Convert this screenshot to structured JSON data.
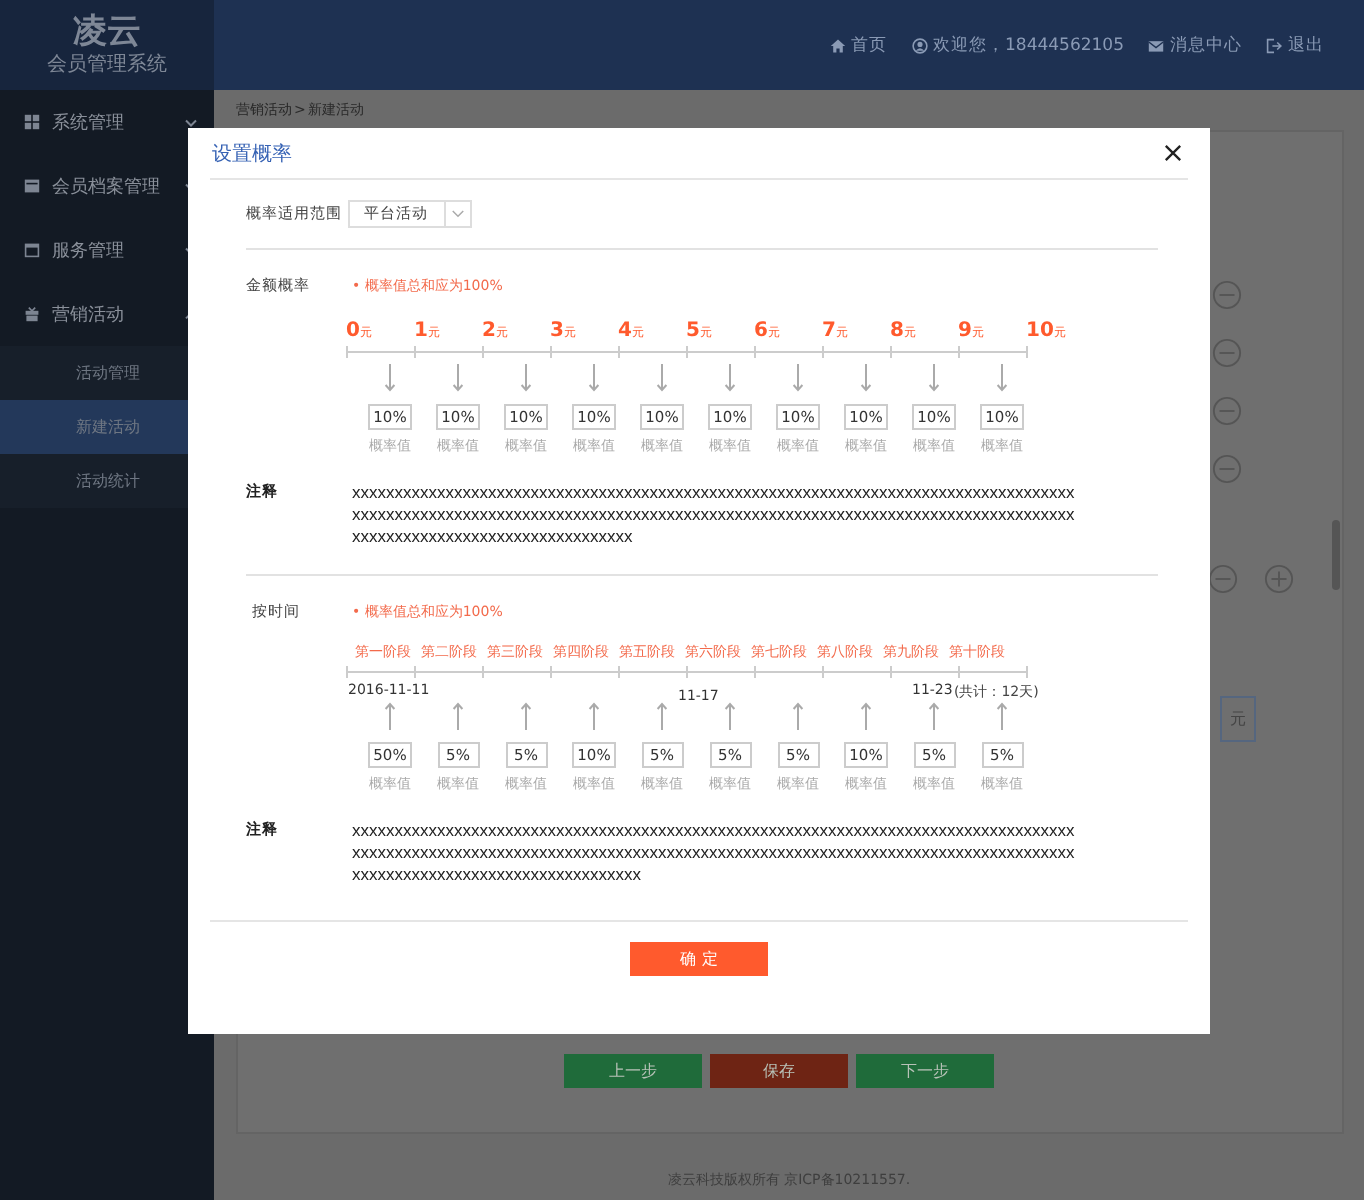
{
  "header": {
    "logo_title": "凌云",
    "logo_subtitle": "会员管理系统",
    "nav": [
      {
        "kind": "home",
        "label": "首页"
      },
      {
        "kind": "user",
        "label": "欢迎您，18444562105"
      },
      {
        "kind": "mail",
        "label": "消息中心"
      },
      {
        "kind": "logout",
        "label": "退出"
      }
    ]
  },
  "sidebar": {
    "items": [
      {
        "kind": "system",
        "label": "系统管理",
        "expanded": false
      },
      {
        "kind": "member",
        "label": "会员档案管理",
        "expanded": false
      },
      {
        "kind": "service",
        "label": "服务管理",
        "expanded": false
      },
      {
        "kind": "marketing",
        "label": "营销活动",
        "expanded": true,
        "children": [
          {
            "label": "活动管理",
            "selected": false
          },
          {
            "label": "新建活动",
            "selected": true
          },
          {
            "label": "活动统计",
            "selected": false
          }
        ]
      }
    ]
  },
  "breadcrumb": {
    "items": [
      "营销活动",
      "新建活动"
    ],
    "separator": ">"
  },
  "background_unit": "元",
  "background_buttons": [
    {
      "label": "上一步",
      "kind": "prev"
    },
    {
      "label": "保存",
      "kind": "save"
    },
    {
      "label": "下一步",
      "kind": "next"
    }
  ],
  "footer": "凌云科技版权所有 京ICP备10211557.",
  "dialog": {
    "title": "设置概率",
    "scope": {
      "label": "概率适用范围",
      "value": "平台活动"
    },
    "amount": {
      "label": "金额概率",
      "hint": "• 概率值总和应为100%",
      "marks": [
        {
          "number": "0",
          "unit": "元"
        },
        {
          "number": "1",
          "unit": "元"
        },
        {
          "number": "2",
          "unit": "元"
        },
        {
          "number": "3",
          "unit": "元"
        },
        {
          "number": "4",
          "unit": "元"
        },
        {
          "number": "5",
          "unit": "元"
        },
        {
          "number": "6",
          "unit": "元"
        },
        {
          "number": "7",
          "unit": "元"
        },
        {
          "number": "8",
          "unit": "元"
        },
        {
          "number": "9",
          "unit": "元"
        },
        {
          "number": "10",
          "unit": "元"
        }
      ],
      "slots": [
        {
          "value": "10%",
          "caption": "概率值"
        },
        {
          "value": "10%",
          "caption": "概率值"
        },
        {
          "value": "10%",
          "caption": "概率值"
        },
        {
          "value": "10%",
          "caption": "概率值"
        },
        {
          "value": "10%",
          "caption": "概率值"
        },
        {
          "value": "10%",
          "caption": "概率值"
        },
        {
          "value": "10%",
          "caption": "概率值"
        },
        {
          "value": "10%",
          "caption": "概率值"
        },
        {
          "value": "10%",
          "caption": "概率值"
        },
        {
          "value": "10%",
          "caption": "概率值"
        }
      ],
      "note": {
        "label": "注释",
        "text": "xxxxxxxxxxxxxxxxxxxxxxxxxxxxxxxxxxxxxxxxxxxxxxxxxxxxxxxxxxxxxxxxxxxxxxxxxxxxxxxxxxxxxxxxxxxxxxxxxxxxxxxxxxxxxxxxxxxxxxxxxxxxxxxxxxxxxxxxxxxxxxxxxxxxxxxxxxxxxxxxxxxxxxxxxxxxxxxxxxxxxxxxxxxxxxxxxxxxxxxxxxx"
      }
    },
    "time": {
      "label": "按时间",
      "hint": "• 概率值总和应为100%",
      "stages": [
        "第一阶段",
        "第二阶段",
        "第三阶段",
        "第四阶段",
        "第五阶段",
        "第六阶段",
        "第七阶段",
        "第八阶段",
        "第九阶段",
        "第十阶段"
      ],
      "dates": [
        {
          "text": "2016-11-11",
          "kind": "start"
        },
        {
          "text": "11-17",
          "kind": "middle"
        },
        {
          "text": "11-23",
          "kind": "end"
        }
      ],
      "total": "(共计：12天)",
      "slots": [
        {
          "value": "50%",
          "caption": "概率值"
        },
        {
          "value": "5%",
          "caption": "概率值"
        },
        {
          "value": "5%",
          "caption": "概率值"
        },
        {
          "value": "10%",
          "caption": "概率值"
        },
        {
          "value": "5%",
          "caption": "概率值"
        },
        {
          "value": "5%",
          "caption": "概率值"
        },
        {
          "value": "5%",
          "caption": "概率值"
        },
        {
          "value": "10%",
          "caption": "概率值"
        },
        {
          "value": "5%",
          "caption": "概率值"
        },
        {
          "value": "5%",
          "caption": "概率值"
        }
      ],
      "note": {
        "label": "注释",
        "text": "xxxxxxxxxxxxxxxxxxxxxxxxxxxxxxxxxxxxxxxxxxxxxxxxxxxxxxxxxxxxxxxxxxxxxxxxxxxxxxxxxxxxxxxxxxxxxxxxxxxxxxxxxxxxxxxxxxxxxxxxxxxxxxxxxxxxxxxxxxxxxxxxxxxxxxxxxxxxxxxxxxxxxxxxxxxxxxxxxxxxxxxxxxxxxxxxxxxxxxxxxxxx"
      }
    },
    "confirm": "确 定"
  }
}
